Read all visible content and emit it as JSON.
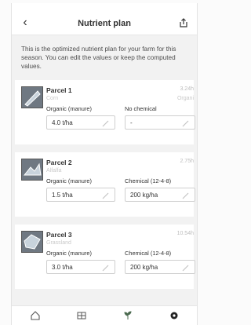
{
  "header": {
    "title": "Nutrient plan"
  },
  "intro": "This is the optimized nutrient plan for your farm for this season. You can edit the values or keep the computed values.",
  "parcels": [
    {
      "name": "Parcel 1",
      "crop": "Corn",
      "area": "3.24h",
      "type": "Organi",
      "organic_label": "Organic (manure)",
      "organic_value": "4.0 t/ha",
      "chemical_label": "No chemical",
      "chemical_value": "-"
    },
    {
      "name": "Parcel 2",
      "crop": "Alfalfa",
      "area": "2.75h",
      "type": "",
      "organic_label": "Organic (manure)",
      "organic_value": "1.5 t/ha",
      "chemical_label": "Chemical (12-4-8)",
      "chemical_value": "200 kg/ha"
    },
    {
      "name": "Parcel 3",
      "crop": "Grassland",
      "area": "10.54h",
      "type": "",
      "organic_label": "Organic (manure)",
      "organic_value": "3.0 t/ha",
      "chemical_label": "Chemical (12-4-8)",
      "chemical_value": "200 kg/ha"
    }
  ],
  "icons": {
    "back": "back-arrow-icon",
    "share": "share-icon",
    "edit": "pencil-icon",
    "nav": [
      "home-icon",
      "map-grid-icon",
      "plant-icon",
      "settings-icon"
    ]
  }
}
